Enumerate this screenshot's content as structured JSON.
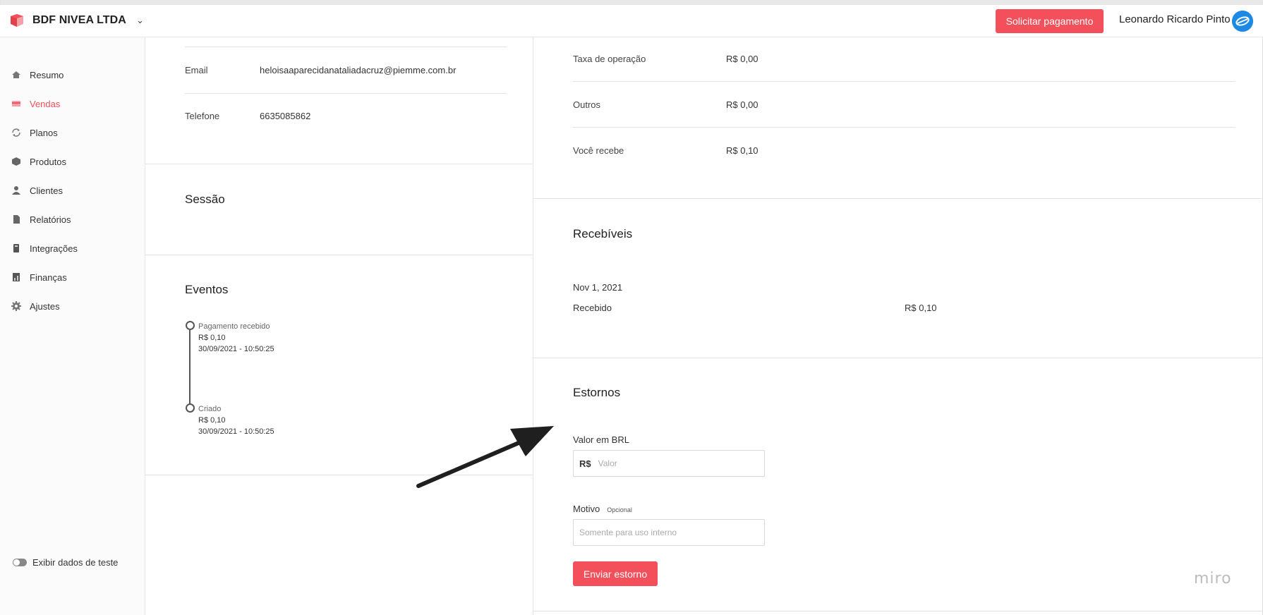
{
  "header": {
    "company": "BDF NIVEA LTDA",
    "pay_button": "Solicitar pagamento",
    "user_name": "Leonardo Ricardo Pinto"
  },
  "sidebar": {
    "items": [
      {
        "label": "Resumo",
        "icon": "home-icon",
        "active": false
      },
      {
        "label": "Vendas",
        "icon": "sales-icon",
        "active": true
      },
      {
        "label": "Planos",
        "icon": "refresh-icon",
        "active": false
      },
      {
        "label": "Produtos",
        "icon": "box-icon",
        "active": false
      },
      {
        "label": "Clientes",
        "icon": "users-icon",
        "active": false
      },
      {
        "label": "Relatórios",
        "icon": "report-icon",
        "active": false
      },
      {
        "label": "Integrações",
        "icon": "integration-icon",
        "active": false
      },
      {
        "label": "Finanças",
        "icon": "finance-icon",
        "active": false
      },
      {
        "label": "Ajustes",
        "icon": "gear-icon",
        "active": false
      }
    ],
    "toggle_label": "Exibir dados de teste"
  },
  "customer": {
    "email_label": "Email",
    "email_value": "heloisaaparecidanataliadacruz@piemme.com.br",
    "phone_label": "Telefone",
    "phone_value": "6635085862"
  },
  "session": {
    "title": "Sessão"
  },
  "events": {
    "title": "Eventos",
    "items": [
      {
        "name": "Pagamento recebido",
        "amount": "R$ 0,10",
        "datetime": "30/09/2021 - 10:50:25"
      },
      {
        "name": "Criado",
        "amount": "R$ 0,10",
        "datetime": "30/09/2021 - 10:50:25"
      }
    ]
  },
  "fees": {
    "rows": [
      {
        "label": "Taxa de operação",
        "value": "R$ 0,00"
      },
      {
        "label": "Outros",
        "value": "R$ 0,00"
      },
      {
        "label": "Você recebe",
        "value": "R$ 0,10"
      }
    ]
  },
  "receivables": {
    "title": "Recebíveis",
    "date": "Nov 1, 2021",
    "status": "Recebido",
    "amount": "R$ 0,10"
  },
  "refunds": {
    "title": "Estornos",
    "value_label": "Valor em BRL",
    "value_prefix": "R$",
    "value_placeholder": "Valor",
    "reason_label": "Motivo",
    "reason_optional": "Opcional",
    "reason_placeholder": "Somente para uso interno",
    "submit": "Enviar estorno"
  },
  "watermark": "miro",
  "colors": {
    "accent": "#f3505b",
    "avatar": "#1e88e5"
  }
}
